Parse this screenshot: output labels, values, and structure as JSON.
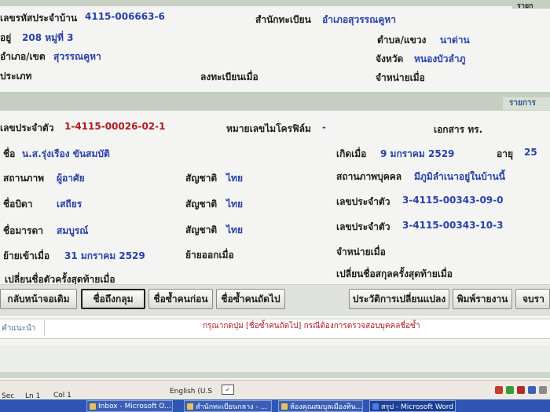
{
  "colors": {
    "label": "#1d1d1d",
    "value": "#2840a8",
    "red": "#b01a22",
    "header": "#c5cec1",
    "band": "#dfe2dc",
    "taskbar": "#2f56b5"
  },
  "header1": {
    "tab": "รายก",
    "house_id_label": "เลขรหัสประจำบ้าน",
    "house_id_value": "4115-006663-6",
    "registry_office_label": "สำนักทะเบียน",
    "registry_office_value": "อำเภอสุวรรณคูหา",
    "address_label": "อยู่",
    "address_value": "208 หมู่ที่ 3",
    "subdistrict_label": "ตำบล/แขวง",
    "subdistrict_value": "นาด่าน",
    "district_label": "อำเภอ/เขต",
    "district_value": "สุวรรณคูหา",
    "province_label": "จังหวัด",
    "province_value": "หนองบัวลำภู",
    "type_label": "ประเภท",
    "registered_label": "ลงทะเบียนเมื่อ",
    "removed_label": "จำหน่ายเมื่อ"
  },
  "header2": {
    "tab": "รายการ"
  },
  "person": {
    "id_label": "เลขประจำตัว",
    "id_value": "1-4115-00026-02-1",
    "microfilm_label": "หมายเลขไมโครฟิล์ม",
    "microfilm_value": "-",
    "doc_label": "เอกสาร ทร.",
    "name_label": "ชื่อ",
    "name_value": "น.ส.รุ่งเรือง ขันสมบัติ",
    "birth_label": "เกิดเมื่อ",
    "birth_value": "9 มกราคม 2529",
    "age_label": "อายุ",
    "age_value": "25",
    "status_label": "สถานภาพ",
    "status_value": "ผู้อาศัย",
    "nationality_label": "สัญชาติ",
    "nationality_value": "ไทย",
    "person_status_label": "สถานภาพบุคคล",
    "person_status_value": "มีภูมิลำเนาอยู่ในบ้านนี้",
    "father_label": "ชื่อบิดา",
    "father_value": "เสถียร",
    "father_nat_label": "สัญชาติ",
    "father_nat_value": "ไทย",
    "father_id_label": "เลขประจำตัว",
    "father_id_value": "3-4115-00343-09-0",
    "mother_label": "ชื่อมารดา",
    "mother_value": "สมบูรณ์",
    "mother_nat_label": "สัญชาติ",
    "mother_nat_value": "ไทย",
    "mother_id_label": "เลขประจำตัว",
    "mother_id_value": "3-4115-00343-10-3",
    "move_in_label": "ย้ายเข้าเมื่อ",
    "move_in_value": "31 มกราคม 2529",
    "move_out_label": "ย้ายออกเมื่อ",
    "removed_label": "จำหน่ายเมื่อ",
    "last_name_change_label": "เปลี่ยนชื่อตัวครั้งสุดท้ายเมื่อ",
    "last_surname_change_label": "เปลี่ยนชื่อสกุลครั้งสุดท้ายเมื่อ"
  },
  "toolbar": {
    "back": "กลับหน้าจอเดิม",
    "first": "ชื่อถึงกลุม",
    "previous": "ชื่อซ้ำคนก่อน",
    "next": "ชื่อซ้ำคนถัดไป",
    "history": "ประวัติการเปลี่ยนแปลง",
    "print": "พิมพ์รายงาน",
    "more": "จบรา"
  },
  "hint": {
    "label": "คำแนะนำ",
    "text": "กรุณากดปุ่ม [ชื่อซ้ำคนถัดไป] กรณีต้องการตรวจสอบบุคคลชื่อซ้ำ"
  },
  "statusbar": {
    "sec": "Sec",
    "ln": "Ln 1",
    "col": "Col 1",
    "language": "English (U.S"
  },
  "taskbar": {
    "items": [
      "Inbox - Microsoft O...",
      "สำนักทะเบียนกลาง - ...",
      "ห้องคุณสมบุลเมืองทิน...",
      "สรุป - Microsoft Word"
    ]
  }
}
